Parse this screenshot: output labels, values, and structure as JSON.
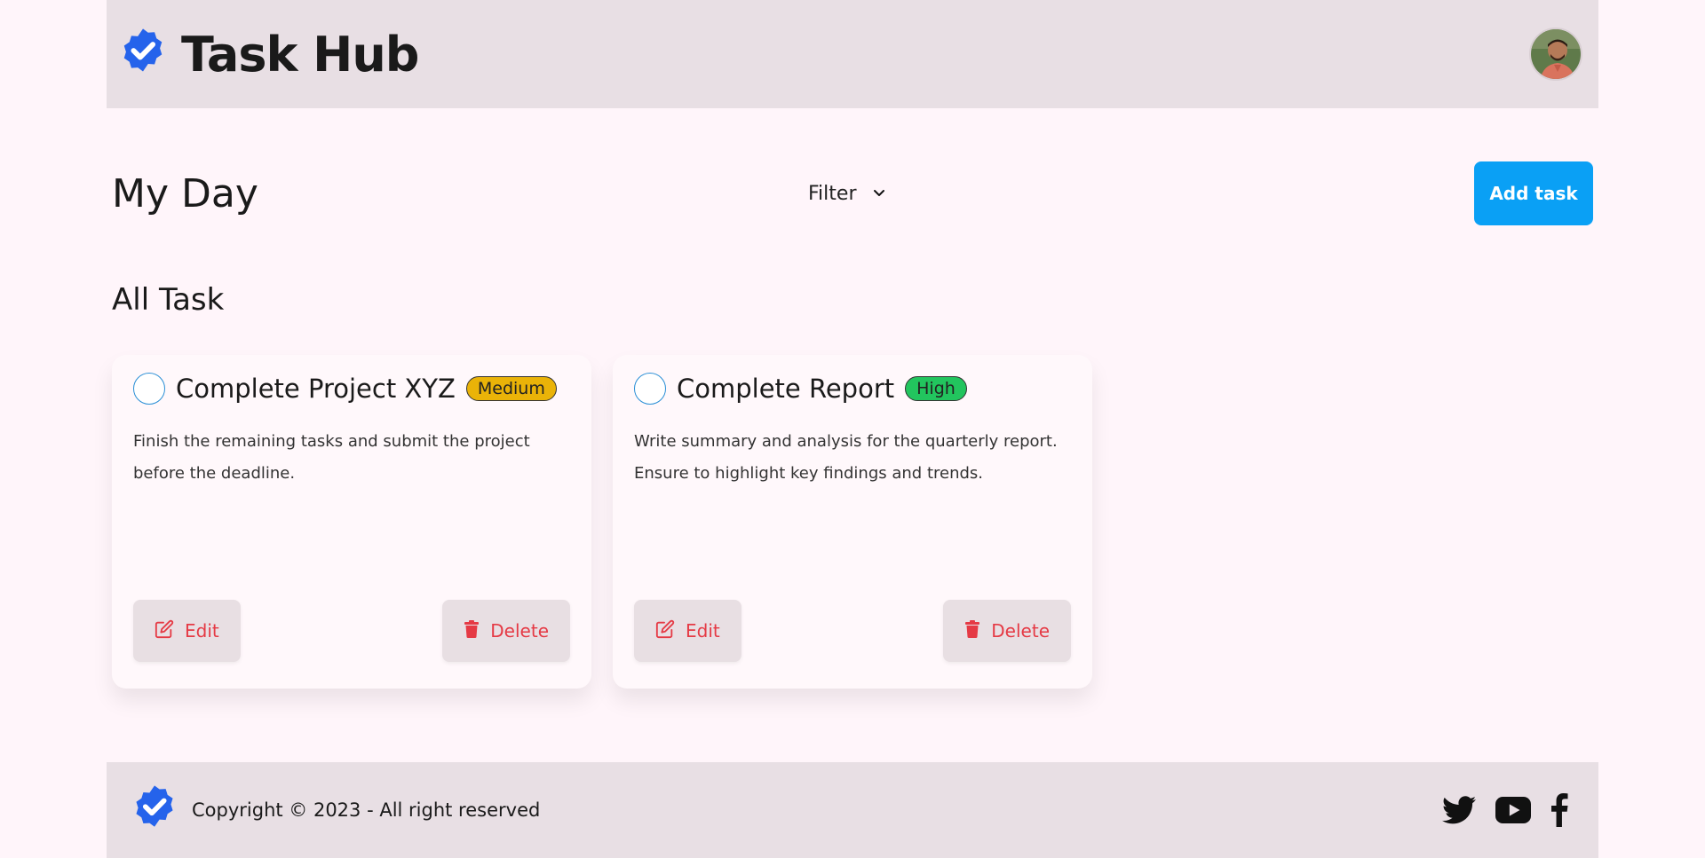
{
  "app": {
    "title": "Task Hub"
  },
  "header": {
    "avatar_icon": "user-avatar"
  },
  "toolbar": {
    "page_title": "My Day",
    "filter_label": "Filter",
    "add_task_label": "Add task"
  },
  "section": {
    "title": "All Task"
  },
  "colors": {
    "accent": "#0aa0f5",
    "brand_icon": "#2563eb",
    "danger": "#e53a45",
    "priority_medium": "#eab308",
    "priority_high": "#22c55e"
  },
  "tasks": [
    {
      "title": "Complete Project XYZ",
      "priority": "Medium",
      "priority_color": "#eab308",
      "description": "Finish the remaining tasks and submit the project before the deadline.",
      "edit_label": "Edit",
      "delete_label": "Delete"
    },
    {
      "title": "Complete Report",
      "priority": "High",
      "priority_color": "#22c55e",
      "description": "Write summary and analysis for the quarterly report. Ensure to highlight key findings and trends.",
      "edit_label": "Edit",
      "delete_label": "Delete"
    }
  ],
  "footer": {
    "copyright": "Copyright © 2023 - All right reserved",
    "socials": [
      "twitter-icon",
      "youtube-icon",
      "facebook-icon"
    ]
  }
}
